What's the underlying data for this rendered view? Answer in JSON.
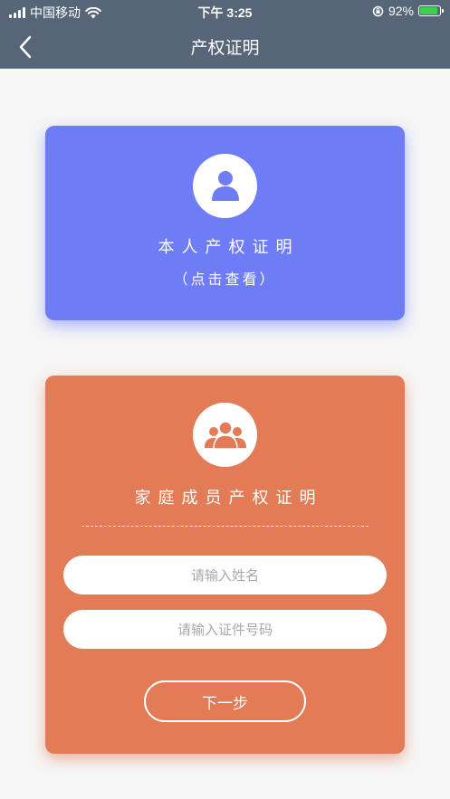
{
  "status_bar": {
    "carrier": "中国移动",
    "time": "下午 3:25",
    "battery": "92%",
    "battery_level": 0.92
  },
  "nav": {
    "title": "产权证明",
    "back_icon": "chevron-left-icon"
  },
  "self_card": {
    "title": "本人产权证明",
    "subtitle": "（点击查看）",
    "icon": "user-icon",
    "color": "#6e7cf6"
  },
  "family_card": {
    "title": "家庭成员产权证明",
    "icon": "group-icon",
    "color": "#e27b56",
    "name_input": {
      "value": "",
      "placeholder": "请输入姓名"
    },
    "id_input": {
      "value": "",
      "placeholder": "请输入证件号码"
    },
    "next_label": "下一步"
  }
}
